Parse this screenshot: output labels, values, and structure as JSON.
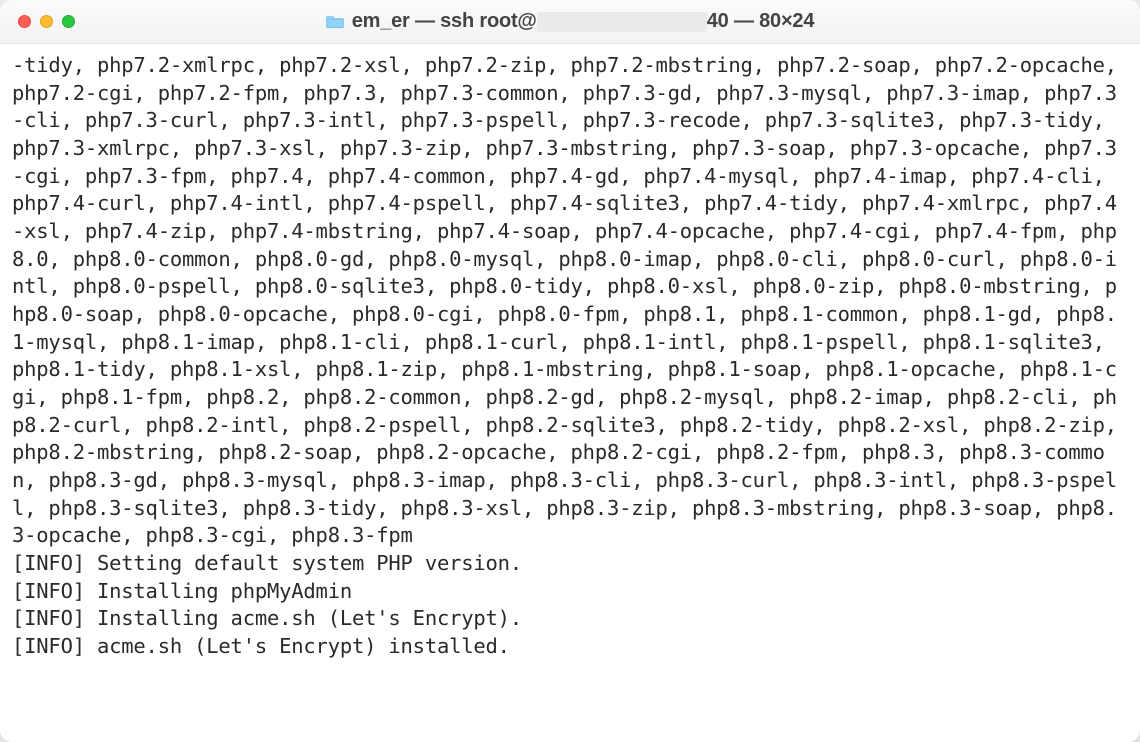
{
  "window": {
    "title_prefix": "em_er — ssh root@",
    "title_suffix": "40 — 80×24",
    "traffic_lights": {
      "close": "close",
      "minimize": "minimize",
      "zoom": "zoom"
    }
  },
  "terminal": {
    "package_list": "-tidy, php7.2-xmlrpc, php7.2-xsl, php7.2-zip, php7.2-mbstring, php7.2-soap, php7.2-opcache, php7.2-cgi, php7.2-fpm, php7.3, php7.3-common, php7.3-gd, php7.3-mysql, php7.3-imap, php7.3-cli, php7.3-curl, php7.3-intl, php7.3-pspell, php7.3-recode, php7.3-sqlite3, php7.3-tidy, php7.3-xmlrpc, php7.3-xsl, php7.3-zip, php7.3-mbstring, php7.3-soap, php7.3-opcache, php7.3-cgi, php7.3-fpm, php7.4, php7.4-common, php7.4-gd, php7.4-mysql, php7.4-imap, php7.4-cli, php7.4-curl, php7.4-intl, php7.4-pspell, php7.4-sqlite3, php7.4-tidy, php7.4-xmlrpc, php7.4-xsl, php7.4-zip, php7.4-mbstring, php7.4-soap, php7.4-opcache, php7.4-cgi, php7.4-fpm, php8.0, php8.0-common, php8.0-gd, php8.0-mysql, php8.0-imap, php8.0-cli, php8.0-curl, php8.0-intl, php8.0-pspell, php8.0-sqlite3, php8.0-tidy, php8.0-xsl, php8.0-zip, php8.0-mbstring, php8.0-soap, php8.0-opcache, php8.0-cgi, php8.0-fpm, php8.1, php8.1-common, php8.1-gd, php8.1-mysql, php8.1-imap, php8.1-cli, php8.1-curl, php8.1-intl, php8.1-pspell, php8.1-sqlite3, php8.1-tidy, php8.1-xsl, php8.1-zip, php8.1-mbstring, php8.1-soap, php8.1-opcache, php8.1-cgi, php8.1-fpm, php8.2, php8.2-common, php8.2-gd, php8.2-mysql, php8.2-imap, php8.2-cli, php8.2-curl, php8.2-intl, php8.2-pspell, php8.2-sqlite3, php8.2-tidy, php8.2-xsl, php8.2-zip, php8.2-mbstring, php8.2-soap, php8.2-opcache, php8.2-cgi, php8.2-fpm, php8.3, php8.3-common, php8.3-gd, php8.3-mysql, php8.3-imap, php8.3-cli, php8.3-curl, php8.3-intl, php8.3-pspell, php8.3-sqlite3, php8.3-tidy, php8.3-xsl, php8.3-zip, php8.3-mbstring, php8.3-soap, php8.3-opcache, php8.3-cgi, php8.3-fpm",
    "log_lines": [
      "[INFO] Setting default system PHP version.",
      "[INFO] Installing phpMyAdmin",
      "[INFO] Installing acme.sh (Let's Encrypt).",
      "[INFO] acme.sh (Let's Encrypt) installed."
    ]
  }
}
